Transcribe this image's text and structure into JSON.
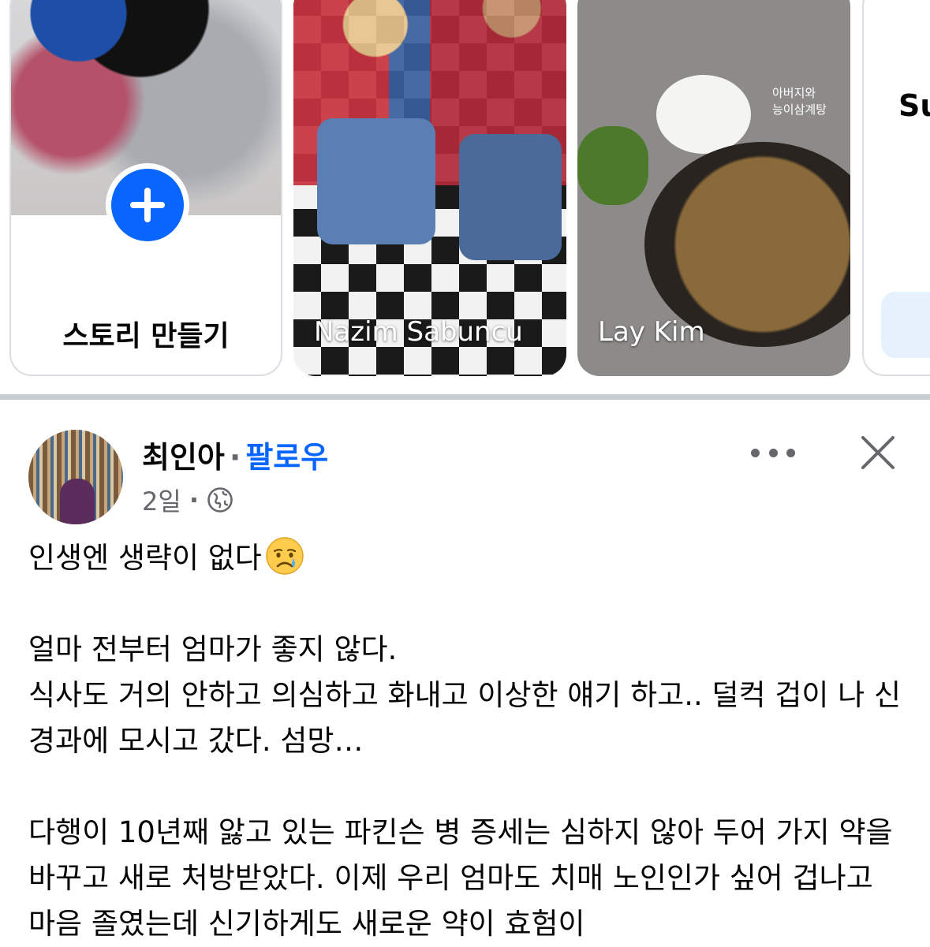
{
  "stories": {
    "create": {
      "label": "스토리 만들기"
    },
    "items": [
      {
        "name": "Nazim Sabuncu"
      },
      {
        "name": "Lay Kim",
        "caption_line1": "아버지와",
        "caption_line2": "능이삼계탕"
      }
    ],
    "peek": {
      "text": "Su"
    }
  },
  "post": {
    "author": "최인아",
    "separator": "·",
    "follow_label": "팔로우",
    "time": "2일",
    "meta_separator": "·",
    "privacy_icon": "globe-icon",
    "body": {
      "line1": "인생엔 생략이 없다",
      "para2": "얼마 전부터 엄마가 좋지 않다.\n식사도 거의 안하고 의심하고 화내고 이상한 얘기 하고.. 덜컥 겁이 나 신경과에 모시고 갔다. 섬망…",
      "para3": "다행이 10년째 앓고 있는 파킨슨 병 증세는 심하지 않아 두어 가지 약을 바꾸고 새로 처방받았다. 이제 우리 엄마도 치매 노인인가 싶어 겁나고 마음 졸였는데 신기하게도 새로운 약이 효험이"
    }
  },
  "colors": {
    "brand_blue": "#0866ff",
    "secondary_text": "#65676b",
    "divider": "#c9ccd1"
  }
}
